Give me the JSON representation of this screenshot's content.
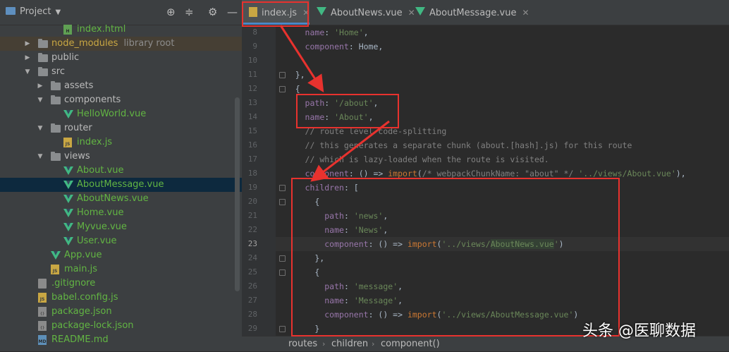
{
  "project": {
    "title": "Project",
    "tree": [
      {
        "label": "index.html",
        "icon": "html-file-icon",
        "level": 4,
        "color": "green"
      },
      {
        "label": "node_modules",
        "extra": "library root",
        "icon": "folder-icon",
        "level": 2,
        "arrow": "collapsed",
        "color": "yellow"
      },
      {
        "label": "public",
        "icon": "folder-icon",
        "level": 2,
        "arrow": "collapsed",
        "color": "norm"
      },
      {
        "label": "src",
        "icon": "folder-icon",
        "level": 2,
        "arrow": "expanded",
        "color": "norm"
      },
      {
        "label": "assets",
        "icon": "folder-icon",
        "level": 3,
        "arrow": "collapsed",
        "color": "norm"
      },
      {
        "label": "components",
        "icon": "folder-icon",
        "level": 3,
        "arrow": "expanded",
        "color": "norm"
      },
      {
        "label": "HelloWorld.vue",
        "icon": "vue-file-icon",
        "level": 4,
        "color": "green"
      },
      {
        "label": "router",
        "icon": "folder-icon",
        "level": 3,
        "arrow": "expanded",
        "color": "norm"
      },
      {
        "label": "index.js",
        "icon": "js-file-icon",
        "level": 4,
        "color": "green"
      },
      {
        "label": "views",
        "icon": "folder-icon",
        "level": 3,
        "arrow": "expanded",
        "color": "norm"
      },
      {
        "label": "About.vue",
        "icon": "vue-file-icon",
        "level": 4,
        "color": "green"
      },
      {
        "label": "AboutMessage.vue",
        "icon": "vue-file-icon",
        "level": 4,
        "color": "green",
        "selected": true
      },
      {
        "label": "AboutNews.vue",
        "icon": "vue-file-icon",
        "level": 4,
        "color": "green"
      },
      {
        "label": "Home.vue",
        "icon": "vue-file-icon",
        "level": 4,
        "color": "green"
      },
      {
        "label": "Myvue.vue",
        "icon": "vue-file-icon",
        "level": 4,
        "color": "green"
      },
      {
        "label": "User.vue",
        "icon": "vue-file-icon",
        "level": 4,
        "color": "green"
      },
      {
        "label": "App.vue",
        "icon": "vue-file-icon",
        "level": 3,
        "color": "green"
      },
      {
        "label": "main.js",
        "icon": "js-file-icon",
        "level": 3,
        "color": "green"
      },
      {
        "label": ".gitignore",
        "icon": "gitignore-file-icon",
        "level": 2,
        "color": "green"
      },
      {
        "label": "babel.config.js",
        "icon": "js-file-icon",
        "level": 2,
        "color": "green"
      },
      {
        "label": "package.json",
        "icon": "json-file-icon",
        "level": 2,
        "color": "green"
      },
      {
        "label": "package-lock.json",
        "icon": "json-file-icon",
        "level": 2,
        "color": "green"
      },
      {
        "label": "README.md",
        "icon": "md-file-icon",
        "level": 2,
        "color": "green"
      }
    ]
  },
  "tabs": [
    {
      "label": "index.js",
      "icon": "js-file-icon",
      "active": true
    },
    {
      "label": "AboutNews.vue",
      "icon": "vue-file-icon"
    },
    {
      "label": "AboutMessage.vue",
      "icon": "vue-file-icon"
    }
  ],
  "editor": {
    "current_line": 23,
    "lines": [
      {
        "n": 8,
        "html": "      <span class=\"k\">name</span>: <span class=\"s\">'Home'</span>,"
      },
      {
        "n": 9,
        "html": "      <span class=\"k\">component</span>: Home,"
      },
      {
        "n": 10,
        "html": ""
      },
      {
        "n": 11,
        "html": "    },"
      },
      {
        "n": 12,
        "html": "    {"
      },
      {
        "n": 13,
        "html": "      <span class=\"k\">path</span>: <span class=\"s\">'/about'</span>,"
      },
      {
        "n": 14,
        "html": "      <span class=\"k\">name</span>: <span class=\"s\">'About'</span>,"
      },
      {
        "n": 15,
        "html": "      <span class=\"c\">// route level code-splitting</span>"
      },
      {
        "n": 16,
        "html": "      <span class=\"c\">// this generates a separate chunk (about.[hash].js) for this route</span>"
      },
      {
        "n": 17,
        "html": "      <span class=\"c\">// which is lazy-loaded when the route is visited.</span>"
      },
      {
        "n": 18,
        "html": "      <span class=\"k\">component</span>: () => <span class=\"kw\">import</span>(<span class=\"c\">/* webpackChunkName: \"about\" */</span> <span class=\"s\">'../views/About.vue'</span>),"
      },
      {
        "n": 19,
        "html": "      <span class=\"k\">children</span>: ["
      },
      {
        "n": 20,
        "html": "        {"
      },
      {
        "n": 21,
        "html": "          <span class=\"k\">path</span>: <span class=\"s\">'news'</span>,"
      },
      {
        "n": 22,
        "html": "          <span class=\"k\">name</span>: <span class=\"s\">'News'</span>,"
      },
      {
        "n": 23,
        "html": "          <span class=\"k\">component</span>: () => <span class=\"kw\">import</span>(<span class=\"s\">'../views/<span class=\"hl\">AboutNews.vue</span>'</span>)"
      },
      {
        "n": 24,
        "html": "        },"
      },
      {
        "n": 25,
        "html": "        {"
      },
      {
        "n": 26,
        "html": "          <span class=\"k\">path</span>: <span class=\"s\">'message'</span>,"
      },
      {
        "n": 27,
        "html": "          <span class=\"k\">name</span>: <span class=\"s\">'Message'</span>,"
      },
      {
        "n": 28,
        "html": "          <span class=\"k\">component</span>: () => <span class=\"kw\">import</span>(<span class=\"s\">'../views/AboutMessage.vue'</span>)"
      },
      {
        "n": 29,
        "html": "        }"
      }
    ]
  },
  "breadcrumb": [
    "routes",
    "children",
    "component()"
  ],
  "watermark": "头条 @医聊数据",
  "colors": {
    "accent": "#4a88c7",
    "annotation": "#e8322e",
    "vue_green": "#41b883"
  }
}
